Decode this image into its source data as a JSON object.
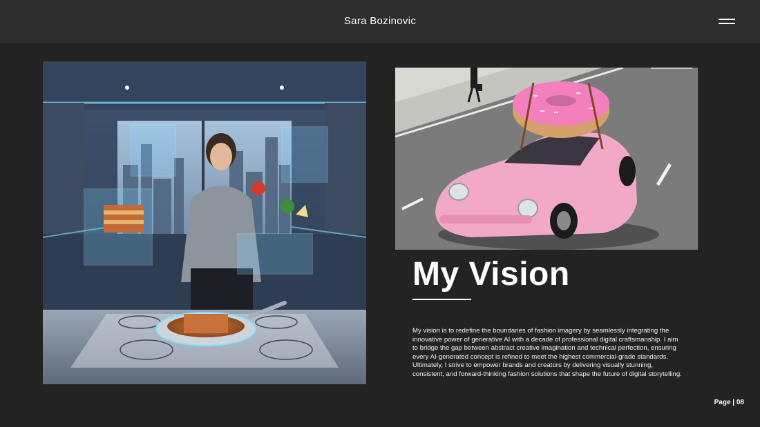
{
  "header": {
    "title": "Sara Bozinovic",
    "menu_icon": "hamburger-menu-icon"
  },
  "images": {
    "left": "kitchen-hologram-photo",
    "right": "pink-donut-car-photo"
  },
  "vision": {
    "title": "My Vision",
    "body": "My vision is to redefine the boundaries of fashion imagery by seamlessly integrating the innovative power of generative AI with a decade of professional digital craftsmanship. I aim to bridge the gap between abstract creative imagination and technical perfection, ensuring every AI-generated concept is refined to meet the highest commercial-grade standards. Ultimately, I strive to empower brands and creators by delivering visually stunning, consistent, and forward-thinking fashion solutions that shape the future of digital storytelling."
  },
  "footer": {
    "page_label": "Page | 08"
  },
  "colors": {
    "background": "#232323",
    "header": "#2d2d2d",
    "text": "#ffffff"
  }
}
